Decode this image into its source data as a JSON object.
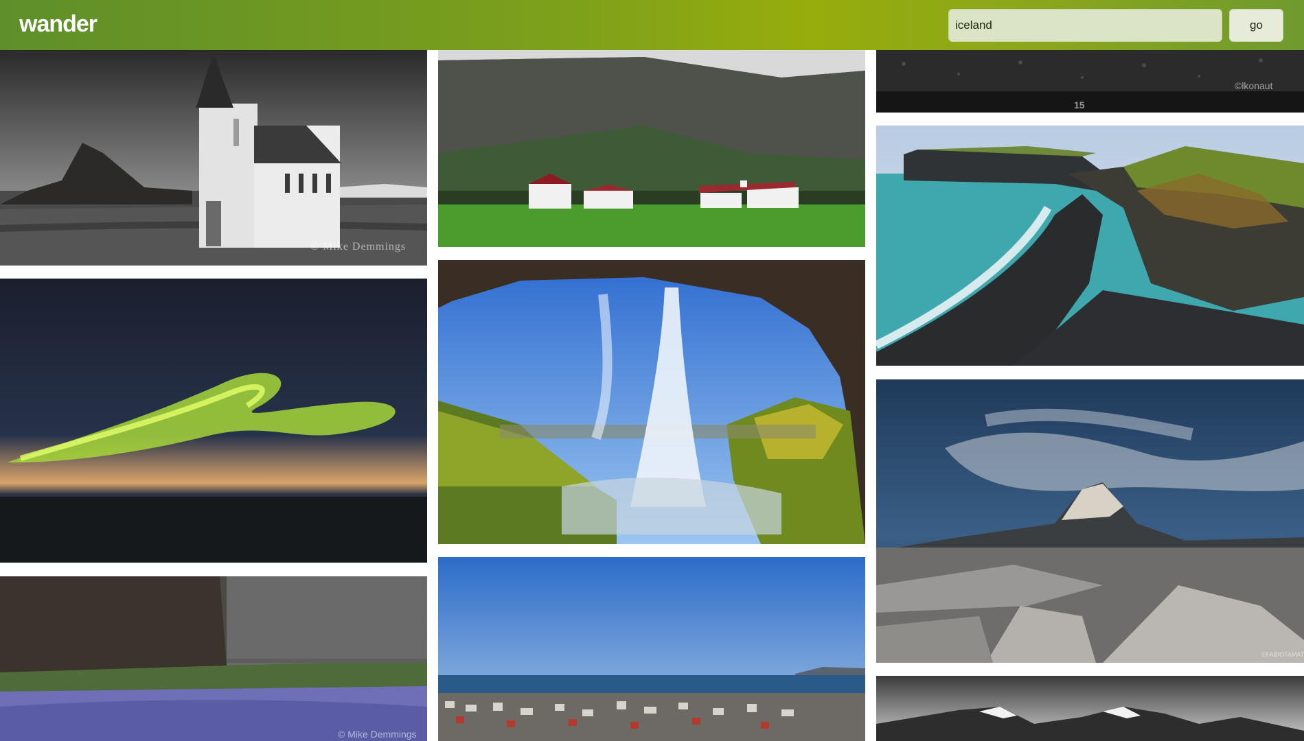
{
  "app": {
    "logo": "wander"
  },
  "search": {
    "value": "iceland",
    "go_label": "go"
  },
  "colors": {
    "header_start": "#5e8f2a",
    "header_mid": "#97ad0c",
    "header_end": "#6f9a2e"
  },
  "photos": [
    {
      "name": "church-photo",
      "credit": "© Mike Demmings"
    },
    {
      "name": "aurora-photo"
    },
    {
      "name": "lupine-cliffs-photo",
      "credit": "© Mike Demmings"
    },
    {
      "name": "farm-valley-photo"
    },
    {
      "name": "waterfall-cave-photo"
    },
    {
      "name": "reykjavik-city-photo"
    },
    {
      "name": "black-sand-photo",
      "credit": "©lkonaut",
      "number": "15"
    },
    {
      "name": "sea-cliffs-beach-photo"
    },
    {
      "name": "kirkjufell-night-photo",
      "credit": "©FABIOTAMAT"
    },
    {
      "name": "snowy-mountains-photo"
    }
  ]
}
